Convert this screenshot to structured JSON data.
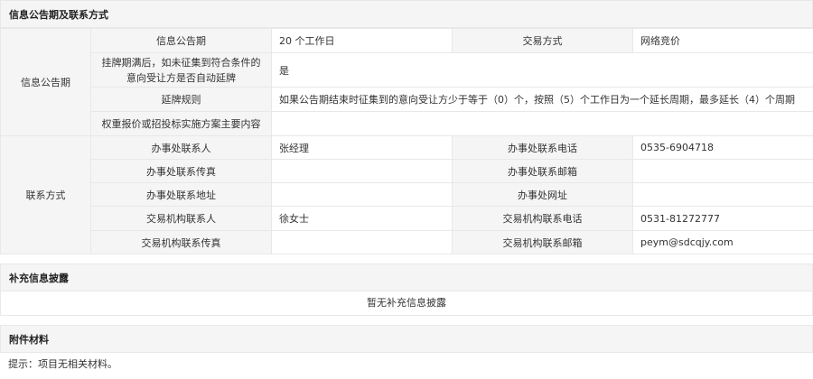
{
  "section_announcement": {
    "title": "信息公告期及联系方式",
    "group_label": "信息公告期",
    "rows": {
      "period_label": "信息公告期",
      "period_value": "20 个工作日",
      "trade_method_label": "交易方式",
      "trade_method_value": "网络竞价",
      "extend_question": "挂牌期满后，如未征集到符合条件的意向受让方是否自动延牌",
      "extend_answer": "是",
      "extend_rule_label": "延牌规则",
      "extend_rule_value": "如果公告期结束时征集到的意向受让方少于等于（0）个，按照（5）个工作日为一个延长周期，最多延长（4）个周期",
      "weight_label": "权重报价或招投标实施方案主要内容",
      "weight_value": ""
    }
  },
  "contacts": {
    "group_label": "联系方式",
    "office_contact_label": "办事处联系人",
    "office_contact_value": "张经理",
    "office_phone_label": "办事处联系电话",
    "office_phone_value": "0535-6904718",
    "office_fax_label": "办事处联系传真",
    "office_fax_value": "",
    "office_email_label": "办事处联系邮箱",
    "office_email_value": "",
    "office_address_label": "办事处联系地址",
    "office_address_value": "",
    "office_website_label": "办事处网址",
    "office_website_value": "",
    "agency_contact_label": "交易机构联系人",
    "agency_contact_value": "徐女士",
    "agency_phone_label": "交易机构联系电话",
    "agency_phone_value": "0531-81272777",
    "agency_fax_label": "交易机构联系传真",
    "agency_fax_value": "",
    "agency_email_label": "交易机构联系邮箱",
    "agency_email_value": "peym@sdcqjy.com"
  },
  "supplement": {
    "title": "补充信息披露",
    "empty_text": "暂无补充信息披露"
  },
  "attachments": {
    "title": "附件材料",
    "note": "提示：项目无相关材料。"
  }
}
